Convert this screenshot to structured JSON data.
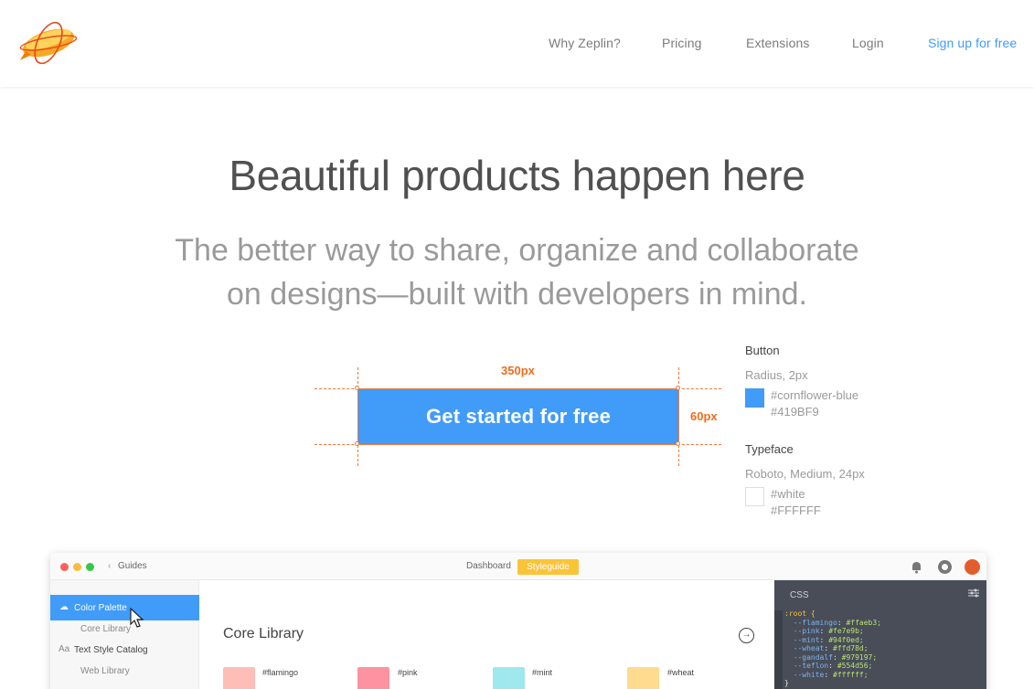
{
  "nav": {
    "items": [
      "Why Zeplin?",
      "Pricing",
      "Extensions",
      "Login"
    ],
    "cta": "Sign up for free"
  },
  "hero": {
    "title": "Beautiful products happen here",
    "subtitle_line1": "The better way to share, organize and collaborate",
    "subtitle_line2": "on designs—built with developers in mind."
  },
  "demo": {
    "width_label": "350px",
    "height_label": "60px",
    "button_label": "Get started for free"
  },
  "spec": {
    "button_heading": "Button",
    "button_radius": "Radius, 2px",
    "button_color_name": "#cornflower-blue",
    "button_color_hex": "#419BF9",
    "type_heading": "Typeface",
    "type_desc": "Roboto, Medium, 24px",
    "type_color_name": "#white",
    "type_color_hex": "#FFFFFF"
  },
  "app": {
    "back_label": "Guides",
    "tab_dashboard": "Dashboard",
    "tab_styleguide": "Styleguide",
    "sidebar": {
      "color_palette": "Color Palette",
      "core_library": "Core Library",
      "text_style_catalog": "Text Style Catalog",
      "web_library": "Web Library"
    },
    "content_title": "Core Library",
    "colors": [
      {
        "name": "#flamingo",
        "hex": "#ffbdb8"
      },
      {
        "name": "#pink",
        "hex": "#fe92a0"
      },
      {
        "name": "#mint",
        "hex": "#9ee8ee"
      },
      {
        "name": "#wheat",
        "hex": "#fedb8f"
      }
    ],
    "css_label": "CSS",
    "css_lines": [
      {
        "prop": "--flamingo",
        "val": "#ffaeb3;"
      },
      {
        "prop": "--pink",
        "val": "#fe7e9b;"
      },
      {
        "prop": "--mint",
        "val": "#94f0ed;"
      },
      {
        "prop": "--wheat",
        "val": "#ffd78d;"
      },
      {
        "prop": "--gandalf",
        "val": "#979197;"
      },
      {
        "prop": "--teflon",
        "val": "#554d56;"
      },
      {
        "prop": "--white",
        "val": "#ffffff;"
      }
    ],
    "css_selector": ":root {",
    "css_close": "}"
  },
  "colors": {
    "accent": "#419BF9",
    "measure": "#EF6C1D",
    "styleguide_tab": "#F9C438"
  },
  "icons": [
    "zeppelin-logo",
    "chevron-left-icon",
    "notification-icon",
    "help-icon",
    "avatar",
    "color-palette-icon",
    "text-style-icon",
    "arrow-right-circle-icon",
    "settings-sliders-icon",
    "mouse-cursor"
  ]
}
